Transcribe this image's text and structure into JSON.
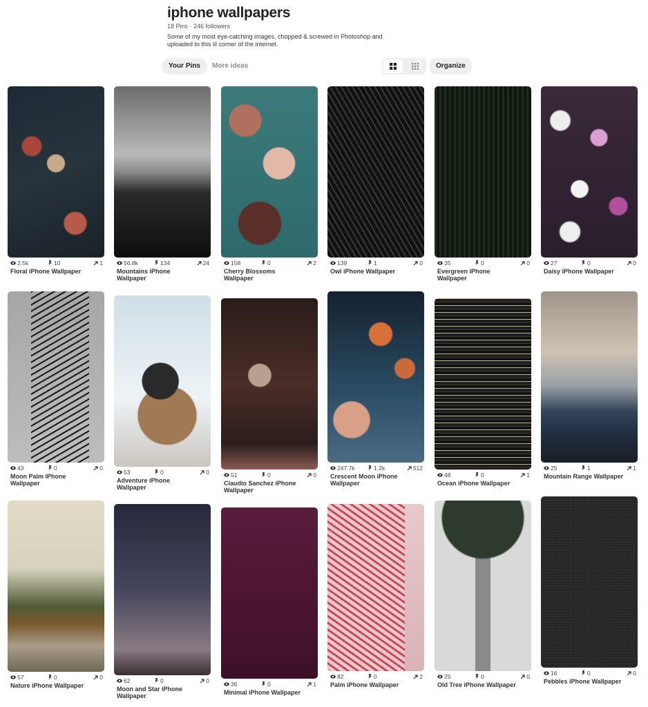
{
  "board": {
    "title": "iphone wallpapers",
    "meta": "18 Pins · 246 followers",
    "description": "Some of my most eye-catching images, chopped & screwed in Photoshop and uploaded to this lil corner of the internet."
  },
  "toolbar": {
    "tab_your_pins": "Your Pins",
    "tab_more_ideas": "More ideas",
    "organize": "Organize"
  },
  "pins": [
    {
      "title": "Floral iPhone Wallpaper",
      "views": "2.5k",
      "saves": "10",
      "shares": "1"
    },
    {
      "title": "Mountains iPhone Wallpaper",
      "views": "56.8k",
      "saves": "134",
      "shares": "24"
    },
    {
      "title": "Cherry Blossoms Wallpaper",
      "views": "158",
      "saves": "0",
      "shares": "2"
    },
    {
      "title": "Owl iPhone Wallpaper",
      "views": "139",
      "saves": "1",
      "shares": "0"
    },
    {
      "title": "Evergreen iPhone Wallpaper",
      "views": "35",
      "saves": "0",
      "shares": "0"
    },
    {
      "title": "Daisy iPhone Wallpaper",
      "views": "27",
      "saves": "0",
      "shares": "0"
    },
    {
      "title": "Moon Palm iPhone Wallpaper",
      "views": "43",
      "saves": "0",
      "shares": "0"
    },
    {
      "title": "Adventure iPhone Wallpaper",
      "views": "53",
      "saves": "0",
      "shares": "0"
    },
    {
      "title": "Claudio Sanchez iPhone Wallpaper",
      "views": "51",
      "saves": "0",
      "shares": "0"
    },
    {
      "title": "Crescent Moon iPhone Wallpaper",
      "views": "247.7k",
      "saves": "1.2k",
      "shares": "512"
    },
    {
      "title": "Ocean iPhone Wallpaper",
      "views": "48",
      "saves": "0",
      "shares": "1"
    },
    {
      "title": "Mountain Range Wallpaper",
      "views": "25",
      "saves": "1",
      "shares": "1"
    },
    {
      "title": "Nature iPhone Wallpaper",
      "views": "57",
      "saves": "0",
      "shares": "0"
    },
    {
      "title": "Moon and Star iPhone Wallpaper",
      "views": "62",
      "saves": "0",
      "shares": "0"
    },
    {
      "title": "Minimal iPhone Wallpaper",
      "views": "36",
      "saves": "0",
      "shares": "1"
    },
    {
      "title": "Palm iPhone Wallpaper",
      "views": "82",
      "saves": "0",
      "shares": "2"
    },
    {
      "title": "Old Tree iPhone Wallpaper",
      "views": "25",
      "saves": "0",
      "shares": "0"
    },
    {
      "title": "Pebbles iPhone Wallpaper",
      "views": "16",
      "saves": "0",
      "shares": "0"
    }
  ]
}
